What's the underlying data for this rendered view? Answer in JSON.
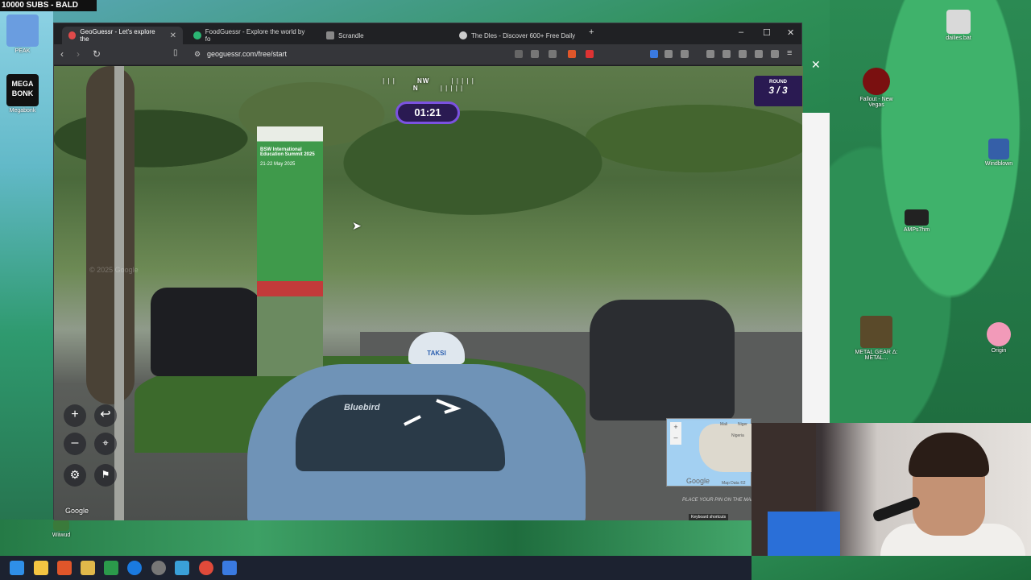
{
  "desktop": {
    "banner": "10000 SUBS - BALD",
    "icons": [
      {
        "label": "PEAK"
      },
      {
        "label": "Megabonk",
        "tile_text": "MEGA BONK"
      },
      {
        "label": "dailies.bat"
      },
      {
        "label": "Fallout - New Vegas"
      },
      {
        "label": "Windblown"
      },
      {
        "label": "AMPs7hm"
      },
      {
        "label": "METAL GEAR Δ: METAL..."
      },
      {
        "label": "Origin"
      },
      {
        "label": "Wiiwud"
      }
    ]
  },
  "browser": {
    "tabs": [
      {
        "label": "GeoGuessr - Let's explore the",
        "color": "#e04a4a",
        "active": true
      },
      {
        "label": "FoodGuessr - Explore the world by fo",
        "color": "#2bb673",
        "active": false
      },
      {
        "label": "Scrandle",
        "color": "#888888",
        "active": false
      },
      {
        "label": "The Dles - Discover 600+ Free Daily",
        "color": "#cccccc",
        "active": false
      }
    ],
    "url": "geoguessr.com/free/start"
  },
  "game": {
    "compass": {
      "left": "NW",
      "right": "N"
    },
    "timer": "01:21",
    "round_label": "ROUND",
    "round_value": "3 / 3",
    "google_label": "Google",
    "map": {
      "labels": [
        "Mali",
        "Niger",
        "Nigeria"
      ],
      "attribution": "Map Data ©2",
      "google": "Google",
      "place_pin": "PLACE YOUR PIN ON THE MAP",
      "keyboard_shortcuts": "Keyboard shortcuts"
    },
    "scene": {
      "taxi_sign": "TAKSI",
      "taxi_brand": "Bluebird",
      "banner_title": "BSW International Education Summit 2025",
      "banner_date": "21-22 May 2025",
      "watermark": "© 2025 Google"
    },
    "controls": [
      "zoom-in",
      "back-to-start",
      "zoom-out",
      "pin",
      "settings",
      "flag"
    ]
  },
  "colors": {
    "accent": "#7b52e0",
    "panel": "#2a1a52"
  }
}
